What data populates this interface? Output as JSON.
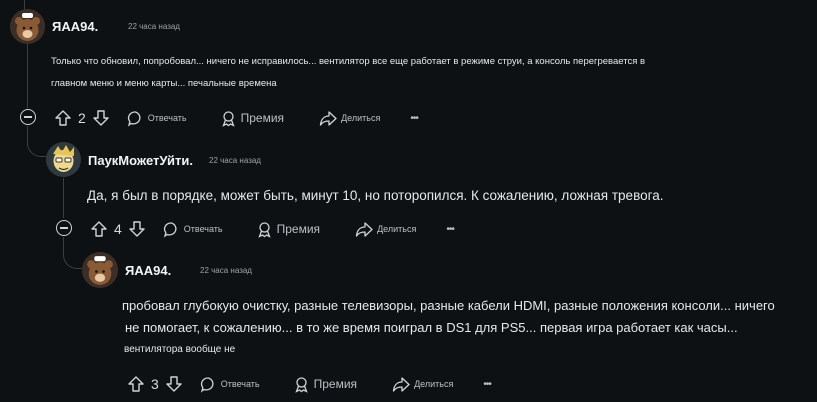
{
  "comments": [
    {
      "username": "ЯАА94.",
      "time": "22 часа назад",
      "text_line1": "Только что обновил, попробовал... ничего не исправилось... вентилятор все еще работает в режиме струи, а консоль перегревается в",
      "text_line2": "главном меню и меню карты... печальные времена",
      "votes": "2",
      "reply_label": "Отвечать",
      "award_label": "Премия",
      "share_label": "Делиться",
      "more_label": "•••",
      "avatar_icon": "bear-avatar-icon"
    },
    {
      "username": "ПаукМожетУйти.",
      "time": "22 часа назад",
      "text_line1": "Да, я был в порядке, может быть, минут 10, но поторопился. К сожалению, ложная тревога.",
      "votes": "4",
      "reply_label": "Отвечать",
      "award_label": "Премия",
      "share_label": "Делиться",
      "more_label": "•••",
      "avatar_icon": "cartoon-avatar-icon"
    },
    {
      "username": "ЯАА94.",
      "time": "22 часа назад",
      "text_line1": "пробовал глубокую очистку, разные телевизоры, разные кабели HDMI, разные положения консоли... ничего",
      "text_line2": "не помогает, к сожалению... в то же время поиграл в DS1 для PS5... первая игра работает как часы...",
      "text_line3": "вентилятора вообще не",
      "votes": "3",
      "reply_label": "Отвечать",
      "award_label": "Премия",
      "share_label": "Делиться",
      "more_label": "•••",
      "avatar_icon": "bear-avatar-icon"
    }
  ],
  "colors": {
    "background": "#0e1113",
    "thread_line": "#3a3f42",
    "text": "#f2f4f5",
    "muted": "#9aa3a6"
  }
}
